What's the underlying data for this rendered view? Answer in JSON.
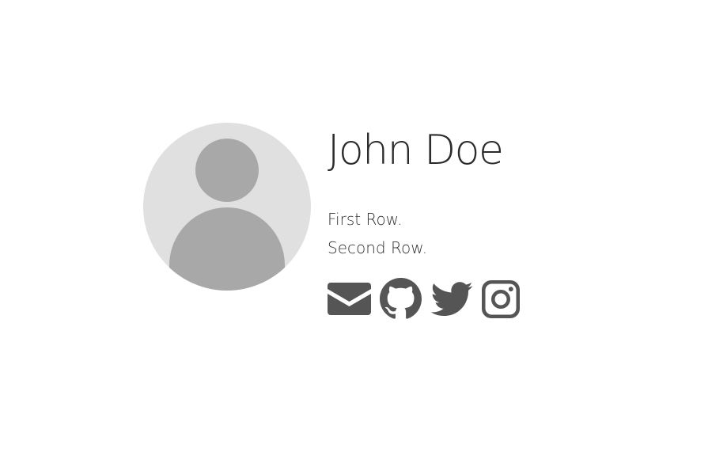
{
  "profile": {
    "name": "John Doe",
    "rows": [
      "First Row.",
      "Second Row."
    ]
  },
  "avatar": {
    "icon": "default-user-avatar-icon",
    "background_color": "#e0e0e0",
    "figure_color": "#a8a8a8"
  },
  "social_links": [
    {
      "icon": "envelope-icon",
      "label": "Email"
    },
    {
      "icon": "github-icon",
      "label": "GitHub"
    },
    {
      "icon": "twitter-icon",
      "label": "Twitter"
    },
    {
      "icon": "instagram-icon",
      "label": "Instagram"
    }
  ],
  "colors": {
    "text": "#333333",
    "icons": "#555555",
    "background": "#ffffff"
  }
}
